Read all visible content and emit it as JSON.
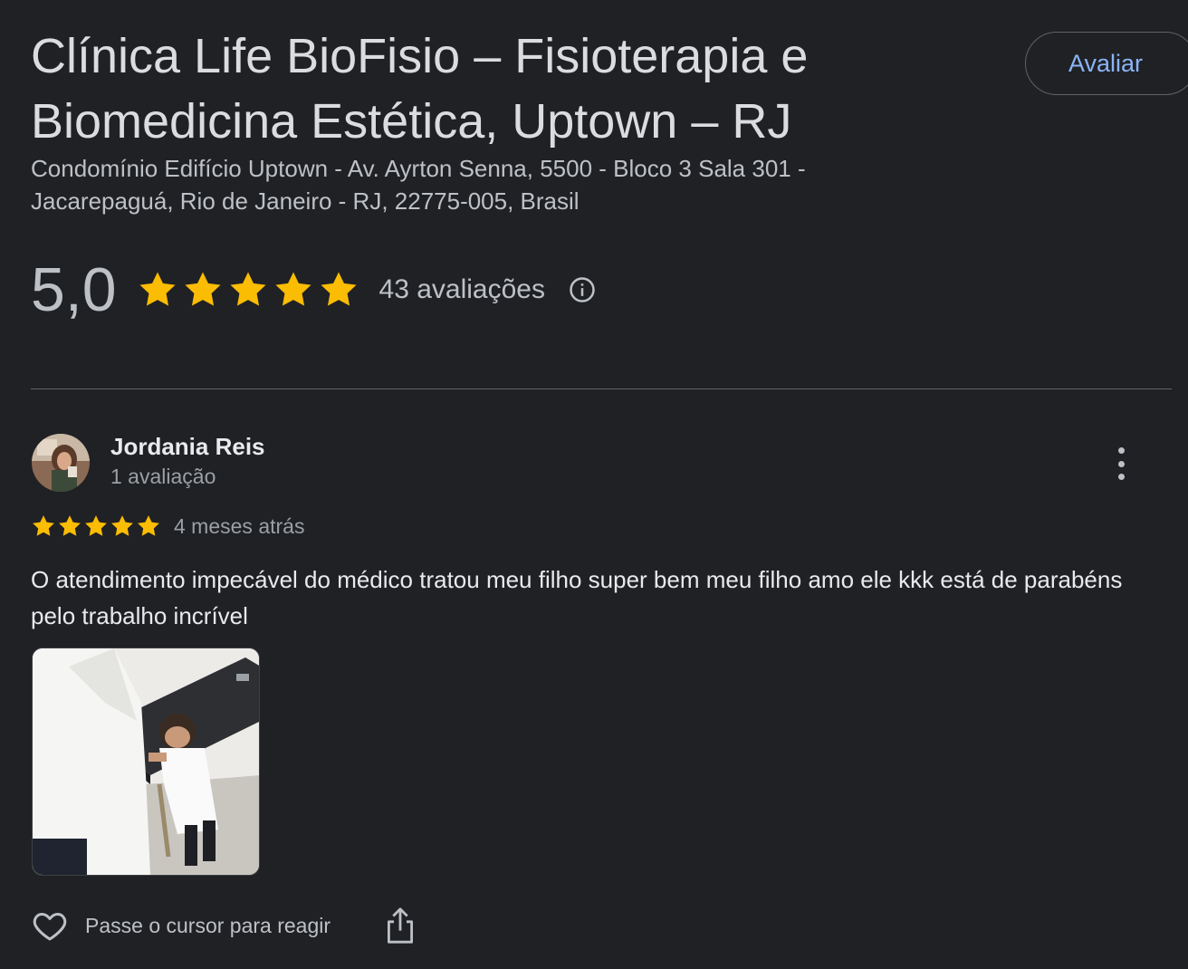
{
  "place": {
    "title": "Clínica Life BioFisio – Fisioterapia e Biomedicina Estética, Uptown – RJ",
    "address": "Condomínio Edifício Uptown - Av. Ayrton Senna, 5500 - Bloco 3 Sala 301 - Jacarepaguá, Rio de Janeiro - RJ, 22775-005, Brasil",
    "rate_button_label": "Avaliar"
  },
  "summary": {
    "rating": "5,0",
    "stars_filled": 5,
    "reviews_count_label": "43 avaliações",
    "info_icon": "info-icon"
  },
  "review": {
    "author": "Jordania Reis",
    "author_reviews": "1 avaliação",
    "stars_filled": 5,
    "time_ago": "4 meses atrás",
    "text": "O atendimento impecável do médico tratou meu filho super bem meu filho amo ele kkk está de parabéns pelo trabalho incrível",
    "react_label": "Passe o cursor para reagir",
    "icons": {
      "avatar": "avatar",
      "more": "more-vert-icon",
      "heart": "heart-icon",
      "share": "share-icon"
    }
  },
  "colors": {
    "background": "#202124",
    "star": "#fbbc04",
    "accent_link": "#8ab4f8",
    "text_primary": "#e8eaed",
    "text_secondary": "#bdc1c6"
  }
}
